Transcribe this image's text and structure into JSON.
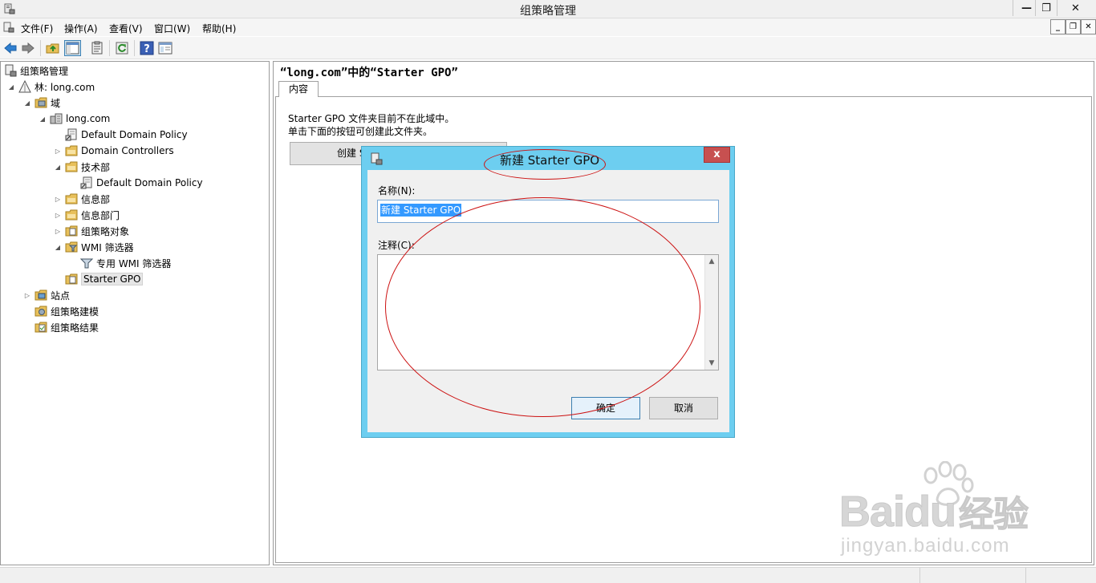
{
  "window": {
    "title": "组策略管理",
    "buttons": {
      "minimize": "▬",
      "restore": "❐",
      "close": "✕"
    }
  },
  "menubar": {
    "items": [
      "文件(F)",
      "操作(A)",
      "查看(V)",
      "窗口(W)",
      "帮助(H)"
    ]
  },
  "toolbar": {
    "icons": [
      "back-arrow-icon",
      "forward-arrow-icon",
      "up-folder-icon",
      "show-hide-tree-icon",
      "properties-icon",
      "refresh-icon",
      "help-icon",
      "console-icon"
    ]
  },
  "tree": {
    "root": "组策略管理",
    "forest": "林: long.com",
    "domains": "域",
    "domain": "long.com",
    "default_policy": "Default Domain Policy",
    "domain_controllers": "Domain Controllers",
    "tech_dept": "技术部",
    "tech_default_policy": "Default Domain Policy",
    "info_dept": "信息部",
    "info_dept2": "信息部门",
    "gpo_objects": "组策略对象",
    "wmi_filters": "WMI 筛选器",
    "wmi_dedicated": "专用 WMI 筛选器",
    "starter_gpo": "Starter GPO",
    "sites": "站点",
    "modeling": "组策略建模",
    "results": "组策略结果"
  },
  "rightpane": {
    "title": "“long.com”中的“Starter GPO”",
    "tab": "内容",
    "line1": "Starter GPO 文件夹目前不在此域中。",
    "line2": "单击下面的按钮可创建此文件夹。",
    "create_button": "创建 S"
  },
  "dialog": {
    "title": "新建 Starter GPO",
    "close": "x",
    "name_label": "名称(N):",
    "name_value": "新建 Starter GPO",
    "comment_label": "注释(C):",
    "ok": "确定",
    "cancel": "取消"
  },
  "watermark": {
    "brand": "Bai",
    "brand_suffix": "du",
    "brand_cn": "经验",
    "site": "jingyan.baidu.com"
  },
  "colors": {
    "dialog_frame": "#6dcef0",
    "close_button": "#c75050",
    "selection": "#3399ff",
    "annotation": "#cc1111"
  }
}
